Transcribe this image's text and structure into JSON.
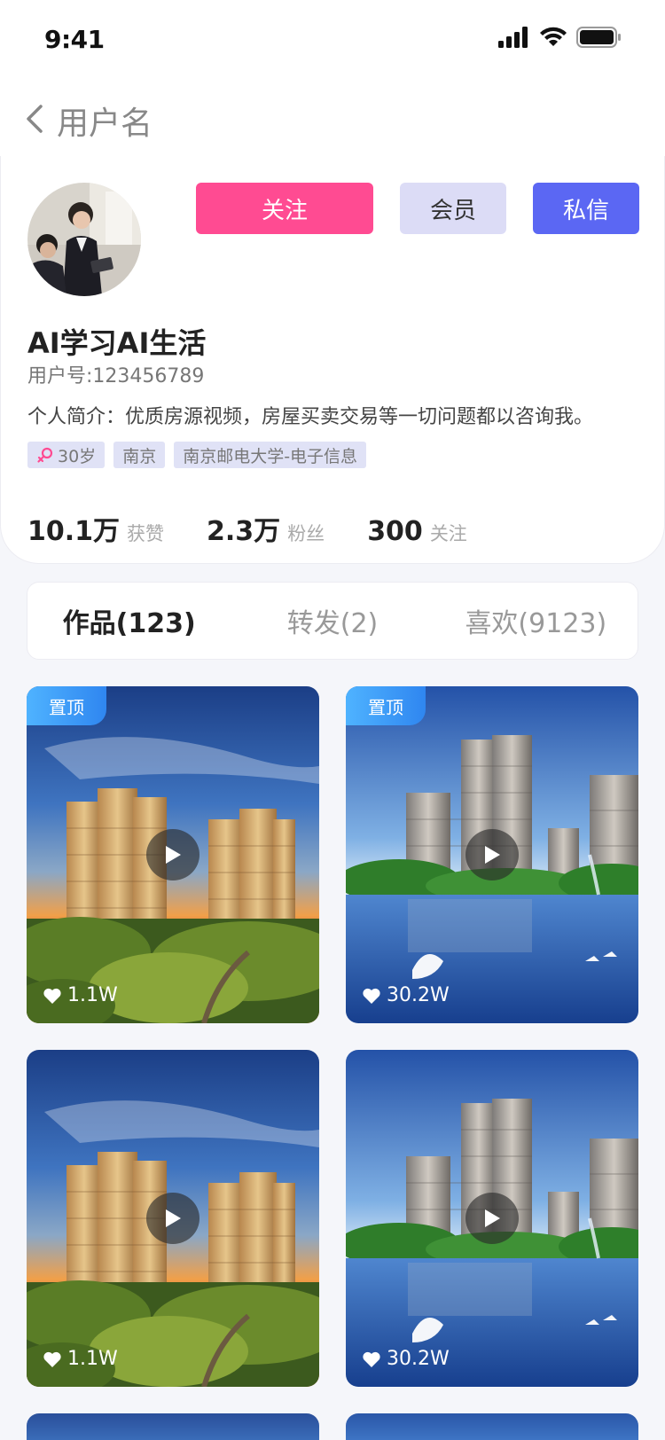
{
  "status": {
    "time": "9:41"
  },
  "nav": {
    "title": "用户名"
  },
  "profile": {
    "follow_label": "关注",
    "vip_label": "会员",
    "message_label": "私信",
    "name": "AI学习AI生活",
    "uid": "用户号:123456789",
    "bio": "个人简介：优质房源视频，房屋买卖交易等一切问题都以咨询我。",
    "tags": [
      "30岁",
      "南京",
      "南京邮电大学-电子信息"
    ],
    "stats": [
      {
        "num": "10.1万",
        "label": "获赞"
      },
      {
        "num": "2.3万",
        "label": "粉丝"
      },
      {
        "num": "300",
        "label": "关注"
      }
    ]
  },
  "tabs": [
    "作品(123)",
    "转发(2)",
    "喜欢(9123)"
  ],
  "videos": [
    {
      "pinned": "置顶",
      "likes": "1.1W",
      "scene": "sunset"
    },
    {
      "pinned": "置顶",
      "likes": "30.2W",
      "scene": "lake"
    },
    {
      "pinned": "",
      "likes": "1.1W",
      "scene": "sunset"
    },
    {
      "pinned": "",
      "likes": "30.2W",
      "scene": "lake"
    }
  ],
  "colors": {
    "follow": "#ff4b92",
    "vip": "#dcdcf6",
    "message": "#5b67f3",
    "pin": "#3a9cf8"
  }
}
